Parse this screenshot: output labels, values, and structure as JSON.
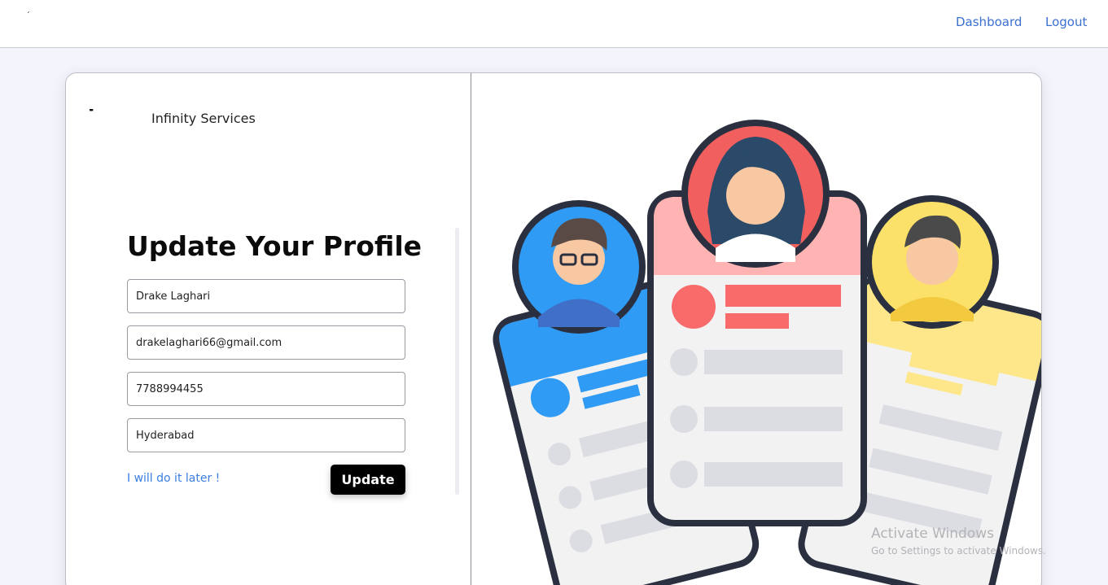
{
  "topbar": {
    "logo_mark": "ˊ",
    "nav": {
      "dashboard": "Dashboard",
      "logout": "Logout"
    }
  },
  "brand": {
    "mark": "╸",
    "name": "Infinity Services"
  },
  "form": {
    "title": "Update Your Profile",
    "fields": {
      "name": "Drake Laghari",
      "email": "drakelaghari66@gmail.com",
      "phone": "7788994455",
      "city": "Hyderabad"
    },
    "later_link": "I will do it later !",
    "update_label": "Update"
  },
  "illustration": {
    "icon": "profile-cards-illustration",
    "colors": {
      "blue": "#2f9bf5",
      "pink": "#ffb3b3",
      "coral": "#f96b6b",
      "yellow": "#fde78a",
      "outline": "#2b3040",
      "placeholder": "#dcdde2"
    }
  },
  "watermark": {
    "title": "Activate Windows",
    "subtitle": "Go to Settings to activate Windows."
  },
  "colors": {
    "accent_link": "#3b6fd0",
    "button_bg": "#000000",
    "page_bg": "#f4f4fc"
  }
}
